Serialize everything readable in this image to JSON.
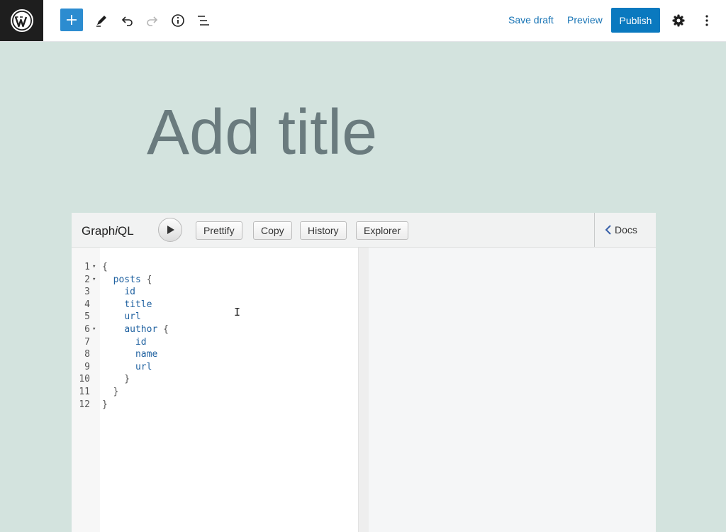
{
  "toolbar": {
    "logo_icon": "wordpress-logo",
    "add_icon": "plus-icon",
    "tools_icon": "pencil-icon",
    "undo_icon": "undo-icon",
    "redo_icon": "redo-icon",
    "info_icon": "info-icon",
    "outline_icon": "list-view-icon",
    "save_draft": "Save draft",
    "preview": "Preview",
    "publish": "Publish",
    "settings_icon": "gear-icon",
    "more_icon": "vertical-ellipsis-icon",
    "accent_color": "#0a79bf"
  },
  "editor": {
    "title_placeholder": "Add title"
  },
  "graphiql": {
    "logo_prefix": "Graph",
    "logo_italic": "i",
    "logo_suffix": "QL",
    "run_icon": "play-icon",
    "buttons": [
      "Prettify",
      "Copy",
      "History",
      "Explorer"
    ],
    "docs_label": "Docs",
    "code": [
      {
        "n": "1",
        "fold": "▾",
        "text": "{"
      },
      {
        "n": "2",
        "fold": "▾",
        "indent": "  ",
        "field": "posts",
        "tail": " {"
      },
      {
        "n": "3",
        "fold": "",
        "indent": "    ",
        "field": "id",
        "tail": ""
      },
      {
        "n": "4",
        "fold": "",
        "indent": "    ",
        "field": "title",
        "tail": ""
      },
      {
        "n": "5",
        "fold": "",
        "indent": "    ",
        "field": "url",
        "tail": ""
      },
      {
        "n": "6",
        "fold": "▾",
        "indent": "    ",
        "field": "author",
        "tail": " {"
      },
      {
        "n": "7",
        "fold": "",
        "indent": "      ",
        "field": "id",
        "tail": ""
      },
      {
        "n": "8",
        "fold": "",
        "indent": "      ",
        "field": "name",
        "tail": ""
      },
      {
        "n": "9",
        "fold": "",
        "indent": "      ",
        "field": "url",
        "tail": ""
      },
      {
        "n": "10",
        "fold": "",
        "text": "    }"
      },
      {
        "n": "11",
        "fold": "",
        "text": "  }"
      },
      {
        "n": "12",
        "fold": "",
        "text": "}"
      }
    ]
  }
}
